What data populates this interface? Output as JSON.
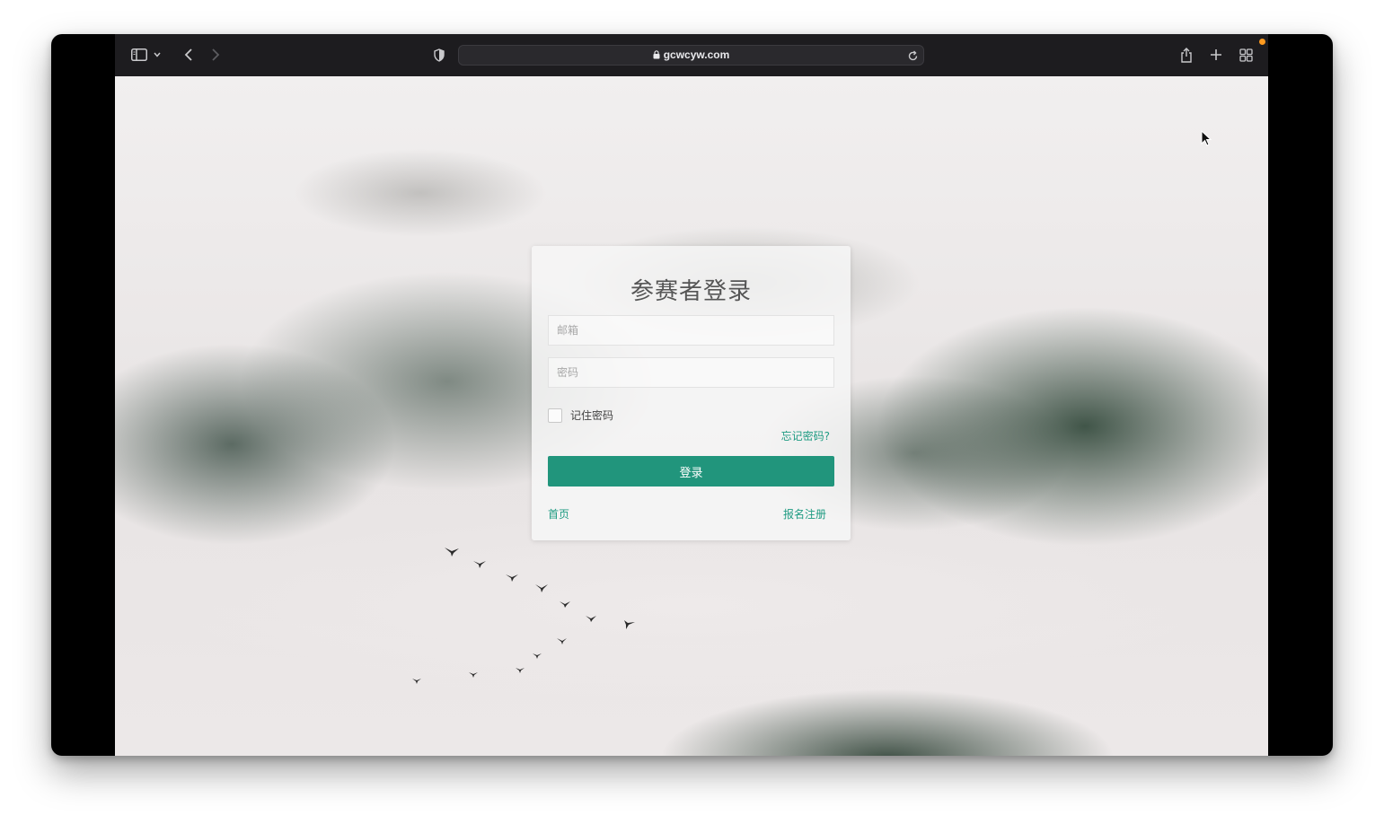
{
  "browser": {
    "url": "gcwcyw.com",
    "icons": [
      "sidebar-icon",
      "chevron-down-icon",
      "back-icon",
      "forward-icon",
      "privacy-shield-icon",
      "lock-icon",
      "reload-icon",
      "share-icon",
      "new-tab-icon",
      "tab-overview-icon"
    ],
    "accent_dot_color": "#ff9a1f"
  },
  "login": {
    "title": "参赛者登录",
    "email_placeholder": "邮箱",
    "password_placeholder": "密码",
    "remember_label": "记住密码",
    "forgot_link": "忘记密码?",
    "submit_label": "登录",
    "home_link": "首页",
    "register_link": "报名注册",
    "accent_color": "#21957c"
  }
}
